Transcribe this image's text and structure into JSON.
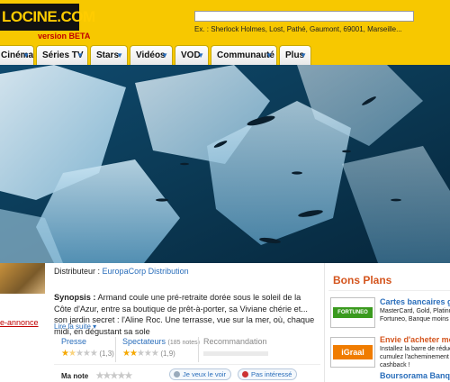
{
  "header": {
    "logo_text": "LOCINE.COM",
    "beta_label": "version BETA",
    "search_placeholder": "",
    "search_hint": "Ex. : Sherlock Holmes, Lost, Pathé, Gaumont, 69001, Marseille..."
  },
  "nav": {
    "tabs": [
      {
        "label": "Cinéma",
        "has_arrow": true
      },
      {
        "label": "Séries TV",
        "has_arrow": true
      },
      {
        "label": "Stars",
        "has_arrow": true
      },
      {
        "label": "Vidéos",
        "has_arrow": true
      },
      {
        "label": "VOD",
        "has_arrow": true
      },
      {
        "label": "Communauté",
        "has_arrow": true
      },
      {
        "label": "Plus",
        "has_arrow": true
      }
    ]
  },
  "left": {
    "trailer_link": "e-annonce"
  },
  "movie": {
    "distributor_label": "Distributeur :",
    "distributor_value": "EuropaCorp Distribution",
    "synopsis_label": "Synopsis :",
    "synopsis_text": "Armand coule une pré-retraite dorée sous le soleil de la Côte d'Azur, entre sa boutique de prêt-à-porter, sa Viviane chérie et... son jardin secret : l'Aline Roc. Une terrasse, vue sur la mer, où, chaque midi, en dégustant sa sole",
    "read_more": "Lire la suite",
    "ratings": {
      "press_label": "Presse",
      "press_score": "(1,3)",
      "press_stars": 1.3,
      "spectators_label": "Spectateurs",
      "spectators_count": "(185 notes)",
      "spectators_score": "(1,9)",
      "spectators_stars": 1.9,
      "recommendation_label": "Recommandation"
    },
    "my_rating_label": "Ma note",
    "want_to_see": "Je veux le voir",
    "not_interested": "Pas intéressé"
  },
  "bons_plans": {
    "title": "Bons Plans",
    "offers": [
      {
        "title": "Cartes bancaires gra",
        "lines": [
          "MasterCard, Gold, Platinum",
          "Fortuneo, Banque moins c"
        ],
        "logo_text": "FORTUNEO",
        "logo_color": "#3a9a1e"
      },
      {
        "title": "Envie d'acheter moin",
        "lines": [
          "Installez la barre de réduc",
          "cumulez l'acheminement codes",
          "cashback !"
        ],
        "logo_text": "iGraal",
        "logo_color": "#f07c00"
      },
      {
        "title": "Boursorama Banque",
        "lines": [],
        "logo_text": "",
        "logo_color": "#1a4f8a"
      }
    ]
  },
  "colors": {
    "brand_yellow": "#f7c800",
    "link_blue": "#2a6ebb",
    "accent_orange": "#d4551e",
    "trailer_red": "#c00000"
  }
}
